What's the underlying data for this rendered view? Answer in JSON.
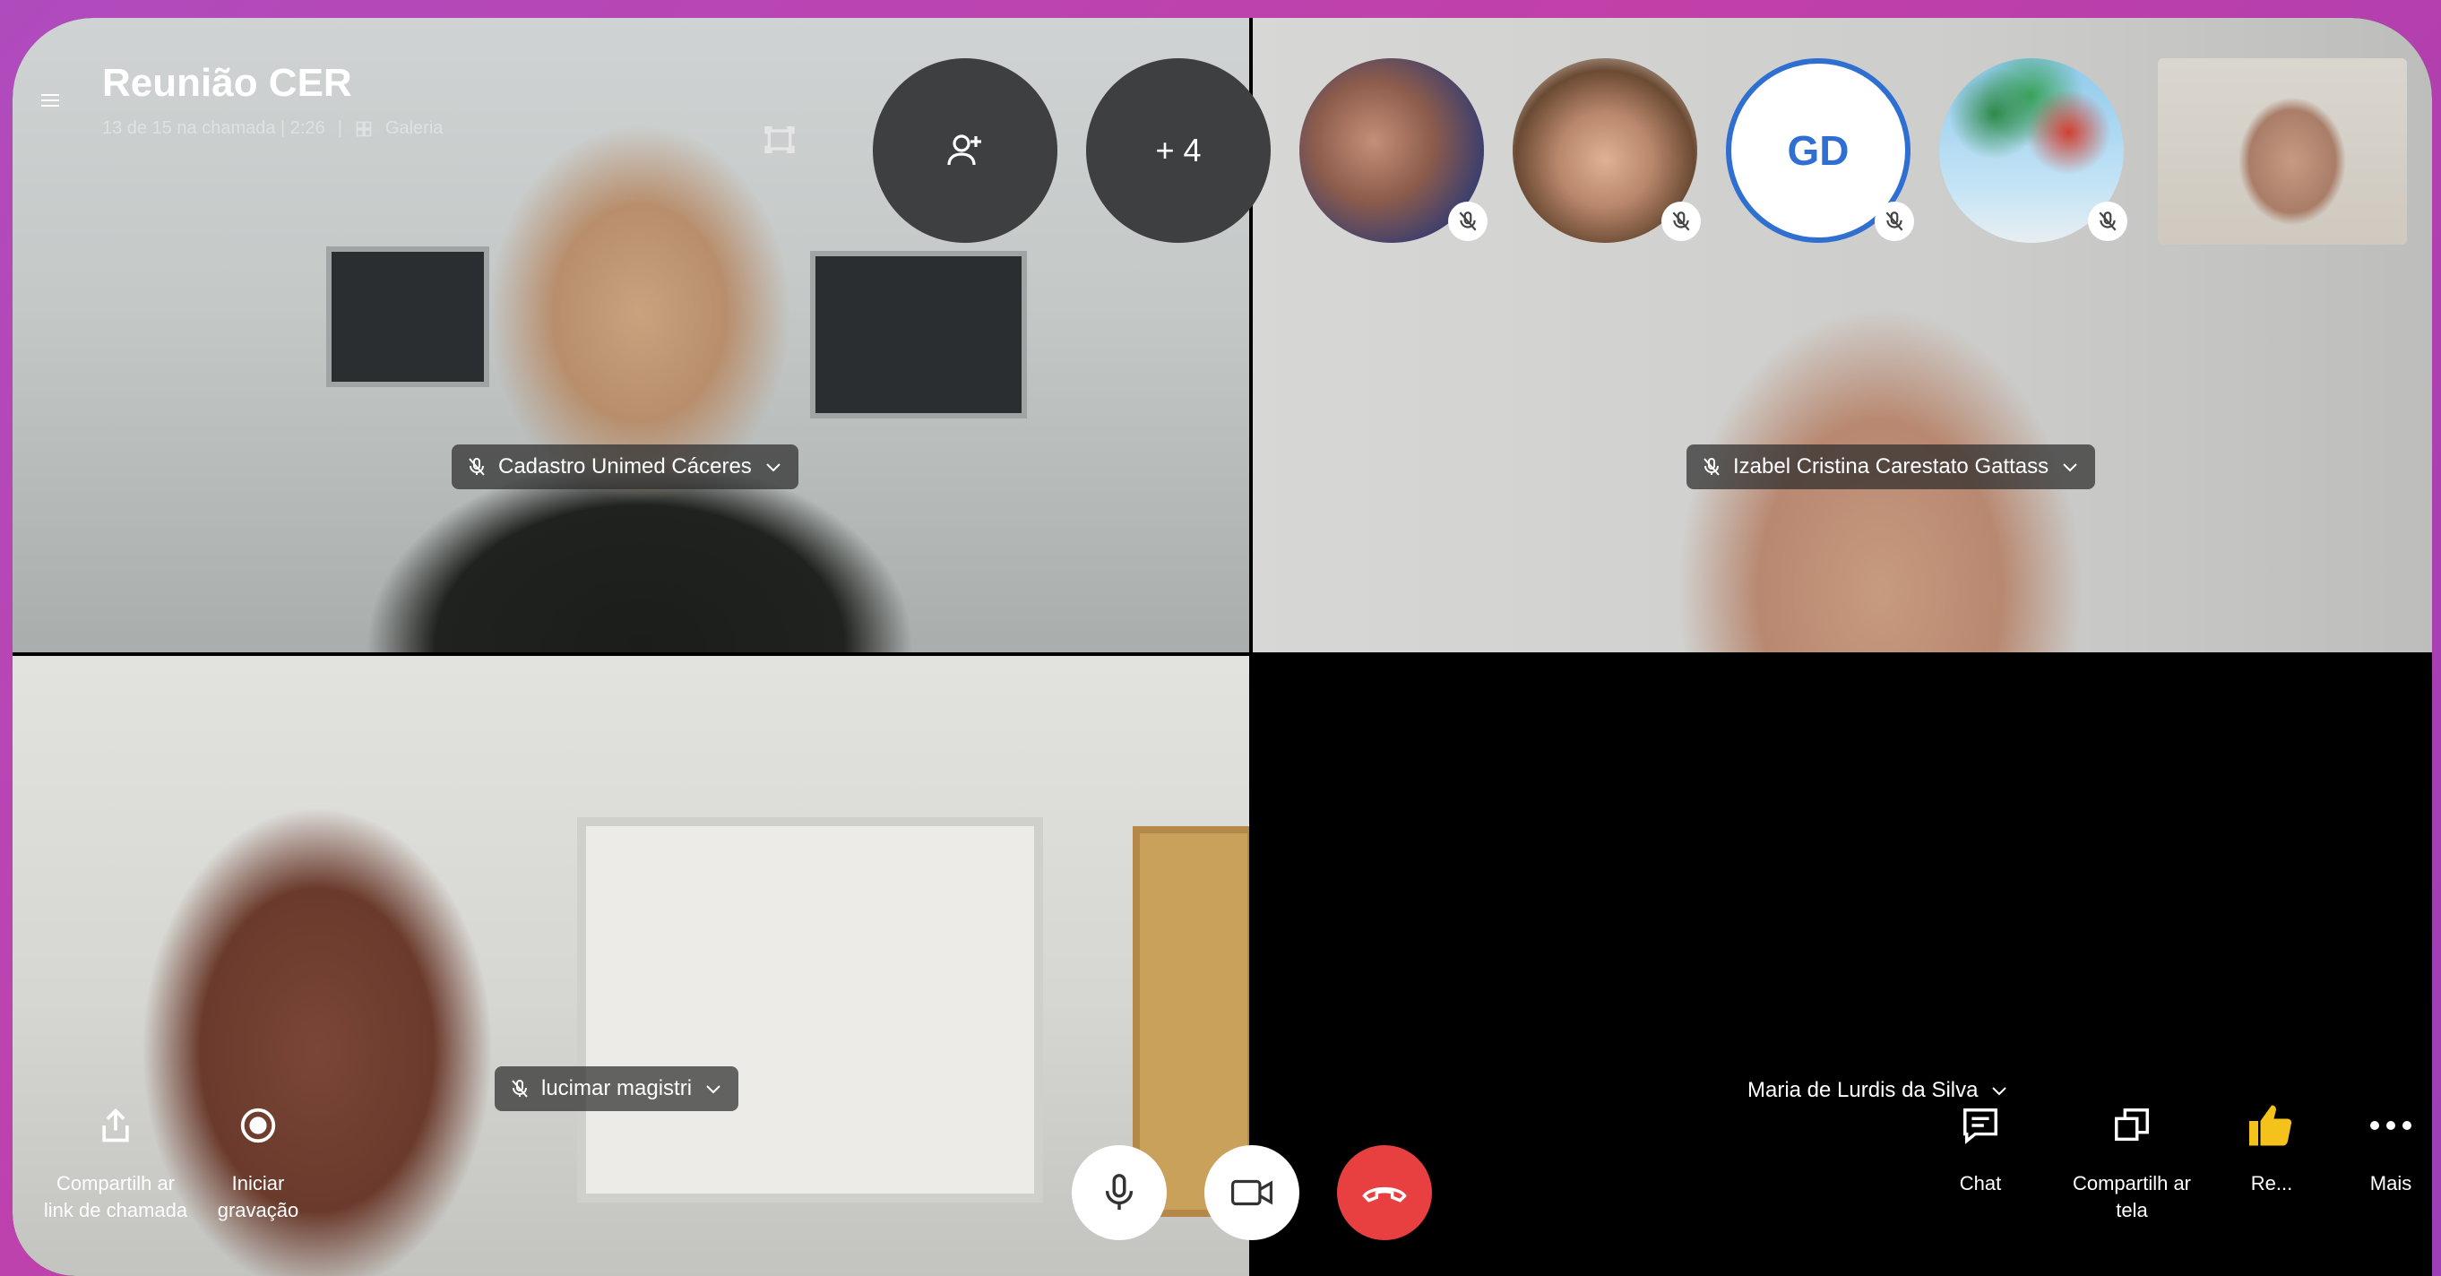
{
  "call": {
    "title": "Reunião CER",
    "status": "13 de 15 na chamada | 2:26",
    "view_mode": "Galeria"
  },
  "header_buttons": {
    "overflow_label": "+ 4"
  },
  "participants": {
    "gd_initials": "GD",
    "tile_top_left": "Cadastro Unimed Cáceres",
    "tile_top_right": "Izabel Cristina Carestato Gattass",
    "tile_bottom_left": "lucimar magistri",
    "tile_bottom_right": "Maria de Lurdis da Silva"
  },
  "left_actions": {
    "share_link": "Compartilh ar link de chamada",
    "record": "Iniciar gravação"
  },
  "right_actions": {
    "chat": "Chat",
    "share_screen": "Compartilh ar tela",
    "react": "Re...",
    "more": "Mais"
  },
  "colors": {
    "end_call": "#e84040",
    "gd_avatar_text": "#2f6fd1",
    "background": "#b04bbd"
  },
  "icons": [
    "menu-icon",
    "grid-icon",
    "layout-icon",
    "add-person-icon",
    "muted-mic-icon",
    "chevron-down-icon",
    "share-icon",
    "record-icon",
    "microphone-icon",
    "video-camera-icon",
    "hang-up-icon",
    "chat-icon",
    "share-screen-icon",
    "thumbs-up-icon",
    "more-icon"
  ]
}
